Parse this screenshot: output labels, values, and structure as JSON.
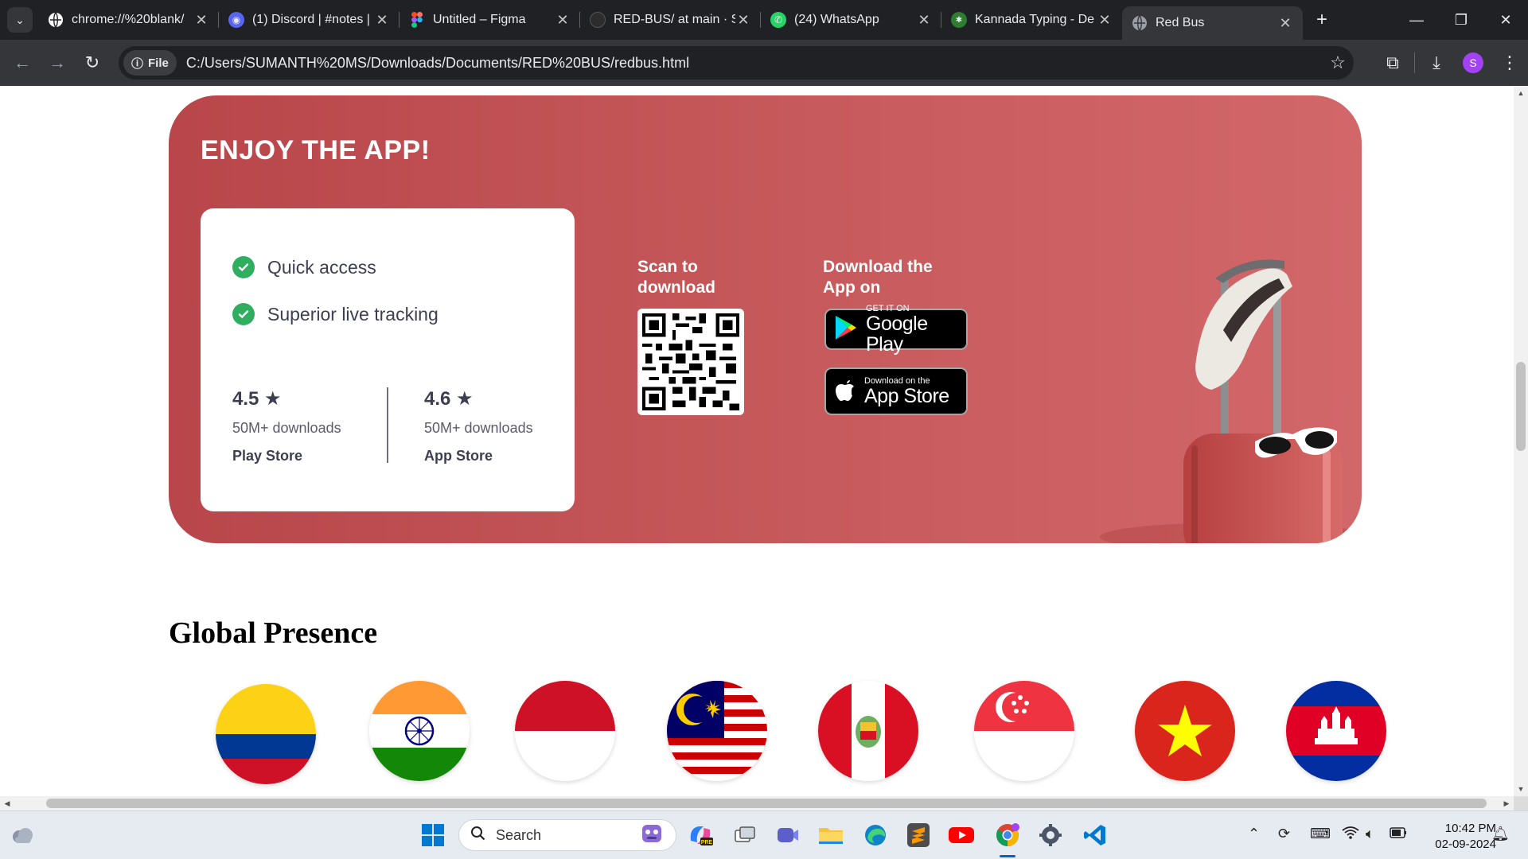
{
  "browser": {
    "tabs": [
      {
        "title": "chrome://%20blank/",
        "icon": "globe-icon",
        "color": "#ffffff"
      },
      {
        "title": "(1) Discord | #notes |",
        "icon": "discord-icon",
        "color": "#5865f2"
      },
      {
        "title": "Untitled – Figma",
        "icon": "figma-icon",
        "color": "#f24e1e"
      },
      {
        "title": "RED-BUS/ at main · S",
        "icon": "github-icon",
        "color": "#2d2d2d"
      },
      {
        "title": "(24) WhatsApp",
        "icon": "whatsapp-icon",
        "color": "#25d366"
      },
      {
        "title": "Kannada Typing - De",
        "icon": "kannada-typing-icon",
        "color": "#2e7d32"
      },
      {
        "title": "Red Bus",
        "icon": "globe-icon",
        "color": "#9aa0a6"
      }
    ],
    "active_tab": 6,
    "address": {
      "chip": "File",
      "url": "C:/Users/SUMANTH%20MS/Downloads/Documents/RED%20BUS/redbus.html"
    },
    "profile_initial": "S"
  },
  "app_section": {
    "title": "ENJOY THE APP!",
    "features": [
      "Quick access",
      "Superior live tracking"
    ],
    "ratings": [
      {
        "value": "4.5",
        "downloads": "50M+ downloads",
        "store": "Play Store"
      },
      {
        "value": "4.6",
        "downloads": "50M+ downloads",
        "store": "App Store"
      }
    ],
    "scan_label": "Scan to download",
    "download_label": "Download the App on",
    "google_play": {
      "small": "GET IT ON",
      "big": "Google Play"
    },
    "app_store": {
      "small": "Download on the",
      "big": "App Store"
    },
    "card_color": "#c2504f"
  },
  "global_presence": {
    "title": "Global Presence",
    "flags": [
      "colombia-flag",
      "india-flag",
      "indonesia-flag",
      "malaysia-flag",
      "peru-flag",
      "singapore-flag",
      "vietnam-flag",
      "cambodia-flag"
    ]
  },
  "taskbar": {
    "search_placeholder": "Search",
    "time": "10:42 PM",
    "date": "02-09-2024"
  }
}
